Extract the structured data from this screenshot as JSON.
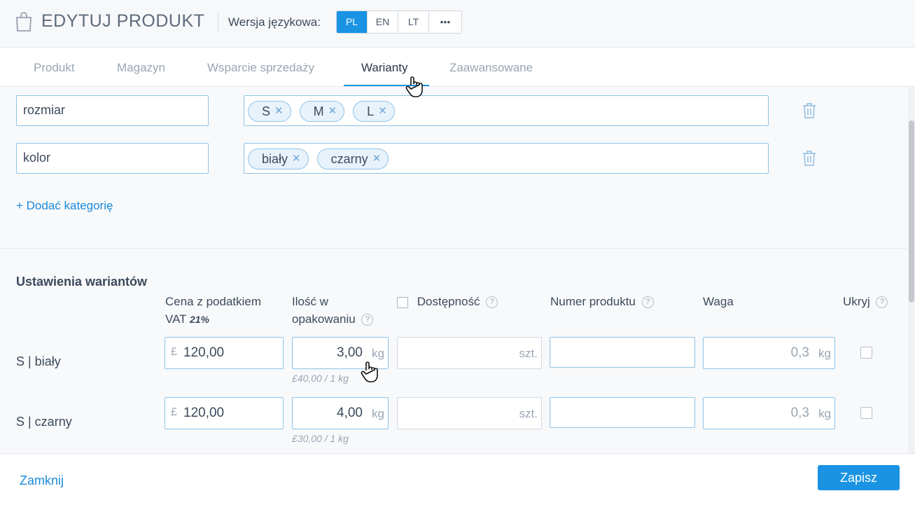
{
  "header": {
    "title": "EDYTUJ PRODUKT",
    "language_label": "Wersja językowa:",
    "languages": [
      "PL",
      "EN",
      "LT",
      "•••"
    ],
    "active_language": "PL"
  },
  "tabs": [
    "Produkt",
    "Magazyn",
    "Wsparcie sprzedaży",
    "Warianty",
    "Zaawansowane"
  ],
  "active_tab": "Warianty",
  "categories": [
    {
      "name": "rozmiar",
      "values": [
        "S",
        "M",
        "L"
      ]
    },
    {
      "name": "kolor",
      "values": [
        "biały",
        "czarny"
      ]
    }
  ],
  "add_category_label": "+  Dodać kategorię",
  "variant_settings": {
    "title": "Ustawienia wariantów",
    "columns": {
      "price_line1": "Cena z podatkiem",
      "price_line2": "VAT",
      "vat_rate": "21%",
      "qty_line1": "Ilość w",
      "qty_line2": "opakowaniu",
      "availability": "Dostępność",
      "product_number": "Numer produktu",
      "weight": "Waga",
      "hide": "Ukryj"
    },
    "rows": [
      {
        "label": "S  |  biały",
        "currency": "£",
        "price": "120,00",
        "qty": "3,00",
        "qty_unit": "kg",
        "unit_price": "£40,00 / 1 kg",
        "availability_unit": "szt.",
        "product_number": "",
        "weight": "0,3",
        "weight_unit": "kg"
      },
      {
        "label": "S  |  czarny",
        "currency": "£",
        "price": "120,00",
        "qty": "4,00",
        "qty_unit": "kg",
        "unit_price": "£30,00 / 1 kg",
        "availability_unit": "szt.",
        "product_number": "",
        "weight": "0,3",
        "weight_unit": "kg"
      }
    ]
  },
  "footer": {
    "close_label": "Zamknij",
    "save_label": "Zapisz"
  },
  "colors": {
    "accent": "#1a93e3",
    "link": "#1a8ad8",
    "border_active": "#8fc3e6"
  },
  "icons": [
    "shopping-bag-icon",
    "trash-icon",
    "help-icon",
    "close-icon",
    "hand-cursor-icon"
  ]
}
